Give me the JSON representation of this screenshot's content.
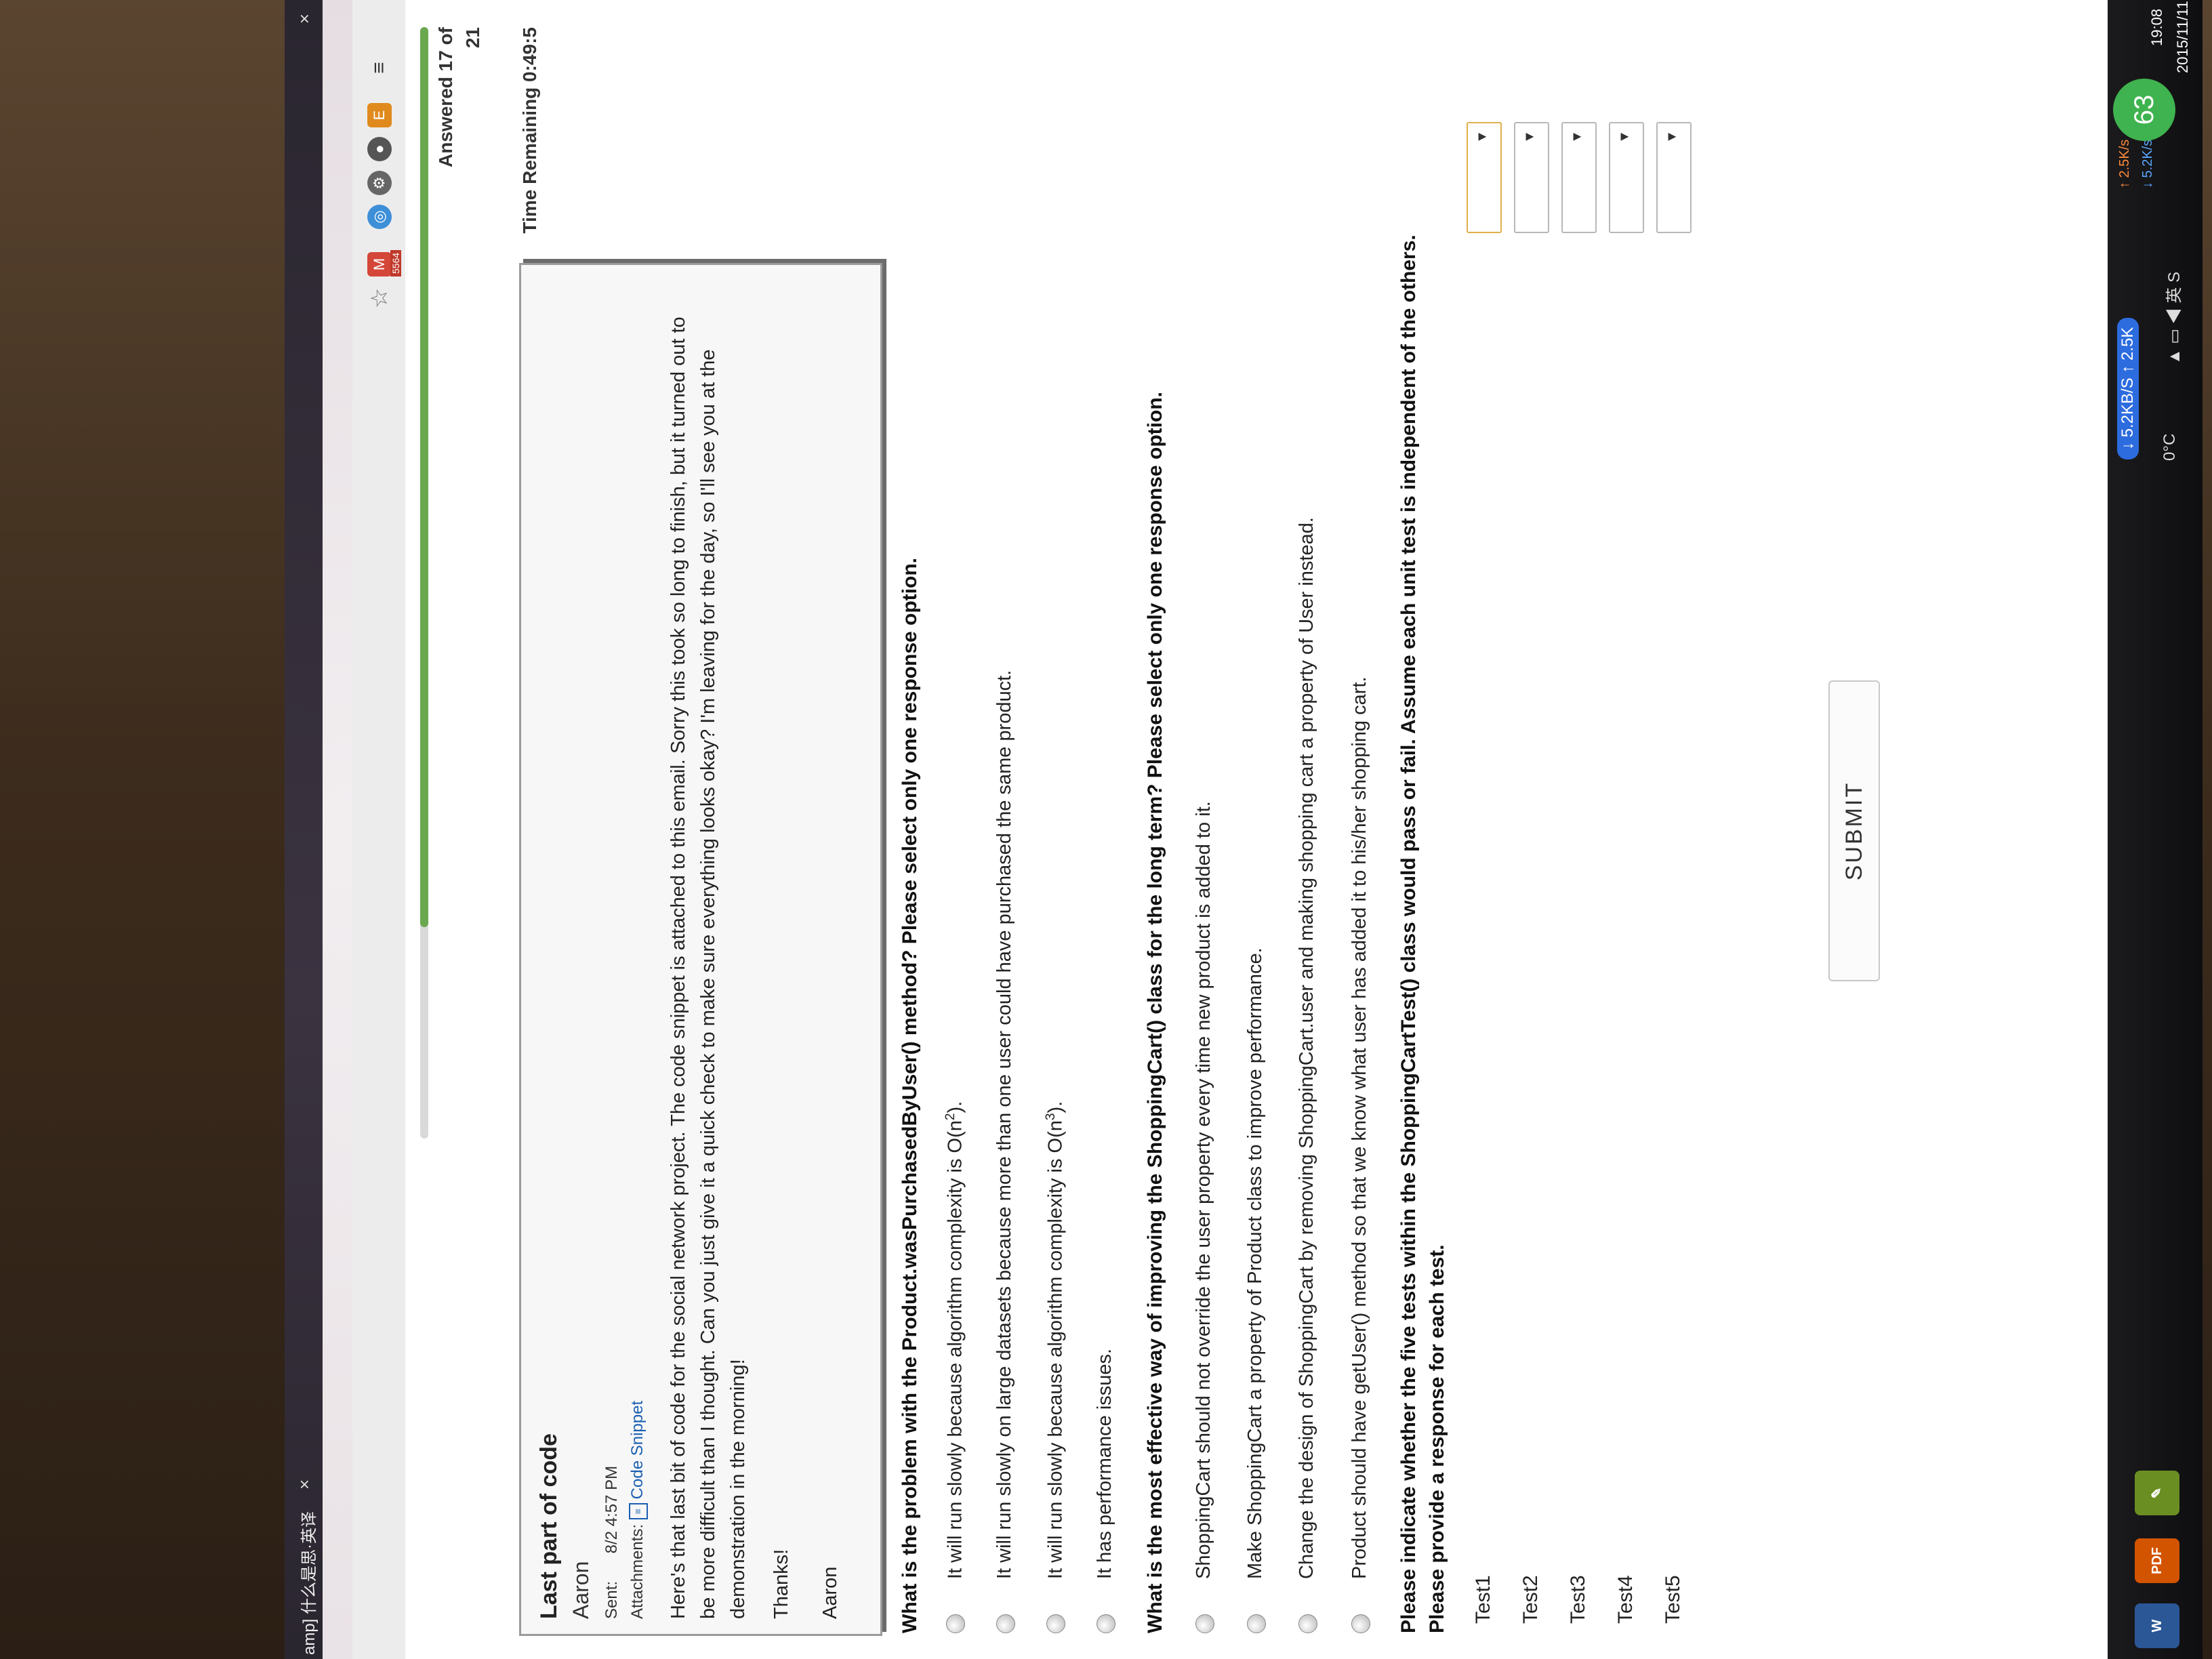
{
  "browser": {
    "tab_title": "amp] 什么是思·英译",
    "tab_close": "×",
    "window_close": "×",
    "gmail_count": "5564",
    "menu_glyph": "≡"
  },
  "progress": {
    "answered_label": "Answered 17 of",
    "answered_total": "21",
    "fraction_answered": 0.81,
    "time_remaining": "Time Remaining 0:49:5"
  },
  "email": {
    "subject": "Last part of code",
    "from": "Aaron",
    "sent_label": "Sent:",
    "sent_value": "8/2 4:57 PM",
    "attachments_label": "Attachments:",
    "attachment_name": "Code Snippet",
    "body": "Here's that last bit of code for the social network project. The code snippet is attached to this email. Sorry this took so long to finish, but it turned out to be more difficult than I thought. Can you just give it a quick check to make sure everything looks okay? I'm leaving for the day, so I'll see you at the demonstration in the morning!",
    "thanks": "Thanks!",
    "signature": "Aaron"
  },
  "question1": {
    "prompt": "What is the problem with the Product.wasPurchasedByUser() method? Please select only one response option.",
    "options": [
      {
        "text": "It will run slowly because algorithm complexity is O(n",
        "sup": "2",
        "tail": ")."
      },
      {
        "text": "It will run slowly on large datasets because more than one user could have purchased the same product.",
        "sup": "",
        "tail": ""
      },
      {
        "text": "It will run slowly because algorithm complexity is O(n",
        "sup": "3",
        "tail": ")."
      },
      {
        "text": "It has performance issues.",
        "sup": "",
        "tail": ""
      }
    ]
  },
  "question2": {
    "prompt": "What is the most effective way of improving the ShoppingCart() class for the long term? Please select only one response option.",
    "options": [
      "ShoppingCart should not override the user property every time new product is added to it.",
      "Make ShoppingCart a property of Product class to improve performance.",
      "Change the design of ShoppingCart by removing ShoppingCart.user and making shopping cart a property of User instead.",
      "Product should have getUser() method so that we know what user has added it to his/her shopping cart."
    ]
  },
  "question3": {
    "prompt_line1": "Please indicate whether the five tests within the ShoppingCartTest() class would pass or fail. Assume each unit test is independent of the others.",
    "prompt_line2": "Please provide a response for each test.",
    "tests": [
      "Test1",
      "Test2",
      "Test3",
      "Test4",
      "Test5"
    ],
    "dropdown_arrow": "▼"
  },
  "submit_label": "SUBMIT",
  "taskbar": {
    "word_label": "W",
    "pdf_label": "PDF",
    "net_down": "↓ 5.2KB/S  ↑ 2.5K",
    "net_up_small": "↑ 2.5K/s",
    "net_down_small": "↓ 5.2K/s",
    "badge": "63",
    "weather": "0°C",
    "tray": "▲  ▭  ◀  英  S",
    "time": "19:08",
    "date": "2015/11/11"
  },
  "colors": {
    "progress_fill": "#6aa84f",
    "link": "#1b5fb3",
    "badge": "#3fb34f"
  }
}
